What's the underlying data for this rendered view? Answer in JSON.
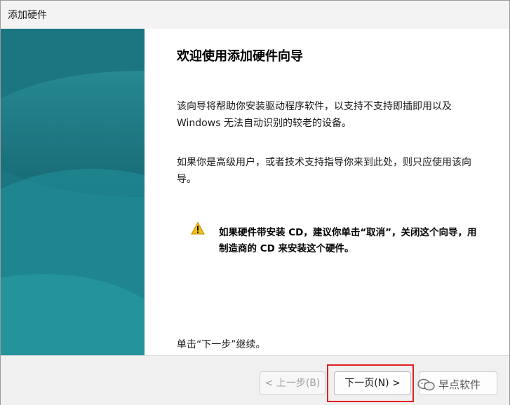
{
  "window": {
    "title": "添加硬件"
  },
  "wizard": {
    "heading": "欢迎使用添加硬件向导",
    "paragraph1": "该向导将帮助你安装驱动程序软件，以支持不支持即插即用以及 Windows 无法自动识别的较老的设备。",
    "paragraph2": "如果你是高级用户，或者技术支持指导你来到此处，则只应使用该向导。",
    "warning_text": "如果硬件带安装 CD，建议你单击“取消”，关闭这个向导，用制造商的 CD 来安装这个硬件。",
    "continue_hint": "单击“下一步”继续。"
  },
  "buttons": {
    "back_label": "< 上一步(B)",
    "next_label": "下一页(N) >",
    "cancel_label": ""
  },
  "watermark": {
    "text": "早点软件"
  },
  "icons": {
    "warning": "warning-icon",
    "watermark_logo": "wechat-logo-icon"
  },
  "colors": {
    "banner": "#1a7c88",
    "highlight": "#e02020"
  }
}
